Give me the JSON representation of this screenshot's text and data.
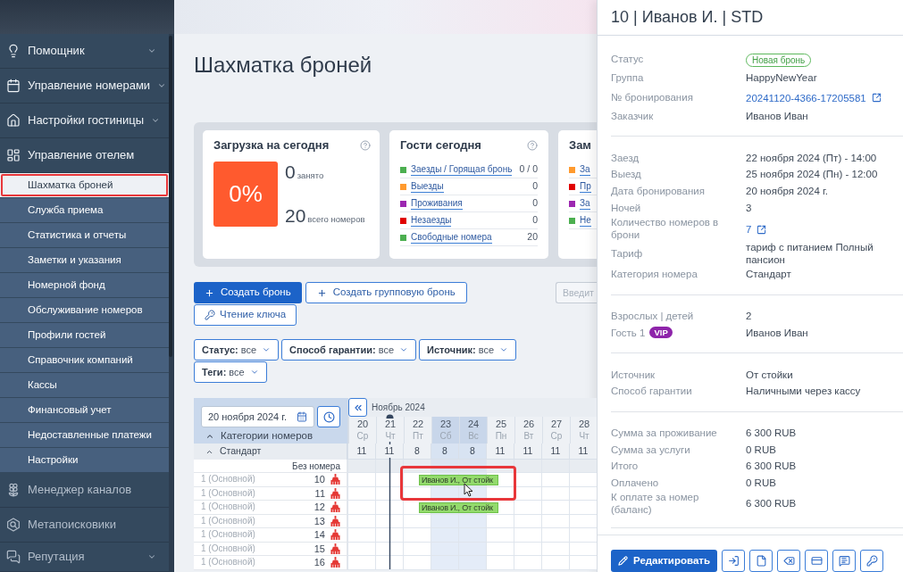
{
  "sidebar": {
    "items": [
      {
        "label": "Помощник",
        "kind": "menu",
        "expanded": false,
        "disabled": false
      },
      {
        "label": "Управление номерами",
        "kind": "menu",
        "expanded": false,
        "disabled": false
      },
      {
        "label": "Настройки гостиницы",
        "kind": "menu",
        "expanded": false,
        "disabled": false
      },
      {
        "label": "Управление отелем",
        "kind": "menu",
        "expanded": true,
        "disabled": false,
        "children": [
          {
            "label": "Шахматка броней",
            "selected": true,
            "highlighted": true
          },
          {
            "label": "Служба приема",
            "selected": false,
            "highlighted": false
          },
          {
            "label": "Статистика и отчеты",
            "selected": false,
            "highlighted": false
          },
          {
            "label": "Заметки и указания",
            "selected": false,
            "highlighted": false
          },
          {
            "label": "Номерной фонд",
            "selected": false,
            "highlighted": false
          },
          {
            "label": "Обслуживание номеров",
            "selected": false,
            "highlighted": false
          },
          {
            "label": "Профили гостей",
            "selected": false,
            "highlighted": false
          },
          {
            "label": "Справочник компаний",
            "selected": false,
            "highlighted": false
          },
          {
            "label": "Кассы",
            "selected": false,
            "highlighted": false
          },
          {
            "label": "Финансовый учет",
            "selected": false,
            "highlighted": false
          },
          {
            "label": "Недоставленные платежи",
            "selected": false,
            "highlighted": false
          },
          {
            "label": "Настройки",
            "selected": false,
            "highlighted": false
          }
        ]
      },
      {
        "label": "Менеджер каналов",
        "kind": "link",
        "disabled": true
      },
      {
        "label": "Метапоисковики",
        "kind": "link",
        "disabled": true
      },
      {
        "label": "Репутация",
        "kind": "menu",
        "expanded": false,
        "disabled": true
      }
    ]
  },
  "page": {
    "title": "Шахматка броней"
  },
  "dashboard": {
    "cards": [
      {
        "kind": "occupancy",
        "title": "Загрузка на сегодня",
        "help": true,
        "percent": "0%",
        "occupied": "0",
        "occupied_label": "занято",
        "total": "20",
        "total_label": "всего номеров"
      },
      {
        "kind": "list",
        "title": "Гости сегодня",
        "help": true,
        "items": [
          {
            "label": "Заезды / Горящая бронь",
            "value": "0 / 0",
            "color": "#4caf50"
          },
          {
            "label": "Выезды",
            "value": "0",
            "color": "#ff9a2e"
          },
          {
            "label": "Проживания",
            "value": "0",
            "color": "#9c27b0"
          },
          {
            "label": "Незаезды",
            "value": "0",
            "color": "#e00000"
          },
          {
            "label": "Свободные номера",
            "value": "20",
            "color": "#4caf50"
          }
        ]
      },
      {
        "kind": "list",
        "title": "Зам",
        "help": false,
        "items": [
          {
            "label": "За",
            "color": "#ff9a2e"
          },
          {
            "label": "Пр",
            "color": "#e00000"
          },
          {
            "label": "За",
            "color": "#9c27b0"
          },
          {
            "label": "Не",
            "color": "#4caf50"
          }
        ]
      }
    ]
  },
  "toolbar": {
    "buttons": [
      {
        "label": "Создать бронь",
        "kind": "primary"
      },
      {
        "label": "Создать групповую бронь",
        "kind": "outline"
      },
      {
        "label": "Чтение ключа",
        "kind": "key"
      }
    ],
    "search": {
      "placeholder": "Введит"
    }
  },
  "filters": [
    {
      "label": "Статус:",
      "value": "все"
    },
    {
      "label": "Способ гарантии:",
      "value": "все"
    },
    {
      "label": "Источник:",
      "value": "все"
    },
    {
      "label": "Теги:",
      "value": "все"
    }
  ],
  "calendar": {
    "date_field": {
      "value": "20 ноября 2024 г."
    },
    "categories_header": {
      "label": "Категории номеров",
      "expanded": true
    },
    "month": "Ноябрь 2024",
    "days": [
      {
        "day": "20",
        "weekday": "Ср",
        "weekend": false
      },
      {
        "day": "21",
        "weekday": "Чт",
        "weekend": false
      },
      {
        "day": "22",
        "weekday": "Пт",
        "weekend": false
      },
      {
        "day": "23",
        "weekday": "Сб",
        "weekend": true
      },
      {
        "day": "24",
        "weekday": "Вс",
        "weekend": true
      },
      {
        "day": "25",
        "weekday": "Пн",
        "weekend": false
      },
      {
        "day": "26",
        "weekday": "Вт",
        "weekend": false
      },
      {
        "day": "27",
        "weekday": "Ср",
        "weekend": false
      },
      {
        "day": "28",
        "weekday": "Чт",
        "weekend": false
      }
    ],
    "category": {
      "name": "Стандарт",
      "expanded": true,
      "availability": [
        "11",
        "11",
        "8",
        "8",
        "8",
        "11",
        "11",
        "11",
        "11"
      ]
    },
    "unassigned": {
      "label": "Без номера"
    },
    "rooms": [
      {
        "type": "1 (Основной)",
        "number": "10",
        "dirty": true,
        "bookings": [
          {
            "label": "Иванов И., От стойк",
            "highlighted": true
          }
        ]
      },
      {
        "type": "1 (Основной)",
        "number": "11",
        "dirty": true
      },
      {
        "type": "1 (Основной)",
        "number": "12",
        "dirty": true,
        "bookings": [
          {
            "label": "Иванов И., От стойк",
            "highlighted": false
          }
        ]
      },
      {
        "type": "1 (Основной)",
        "number": "13",
        "dirty": true
      },
      {
        "type": "1 (Основной)",
        "number": "14",
        "dirty": true
      },
      {
        "type": "1 (Основной)",
        "number": "15",
        "dirty": true
      },
      {
        "type": "1 (Основной)",
        "number": "16",
        "dirty": true
      }
    ]
  },
  "details": {
    "title": "10 | Иванов И. | STD",
    "sections": [
      {
        "rows": [
          {
            "label": "Статус",
            "value": "Новая бронь",
            "kind": "badge"
          },
          {
            "label": "Группа",
            "value": "HappyNewYear",
            "kind": "text"
          },
          {
            "label": "№ бронирования",
            "value": "20241120-4366-17205581",
            "kind": "link"
          },
          {
            "label": "Заказчик",
            "value": "Иванов Иван",
            "kind": "text"
          }
        ]
      },
      {
        "rows": [
          {
            "label": "Заезд",
            "value": "22 ноября 2024 (Пт) - 14:00",
            "kind": "text"
          },
          {
            "label": "Выезд",
            "value": "25 ноября 2024 (Пн) - 12:00",
            "kind": "text"
          },
          {
            "label": "Дата бронирования",
            "value": "20 ноября 2024 г.",
            "kind": "text"
          },
          {
            "label": "Ночей",
            "value": "3",
            "kind": "text"
          },
          {
            "label": "Количество номеров в брони",
            "value": "7",
            "kind": "link"
          },
          {
            "label": "Тариф",
            "value": "тариф с питанием Полный пансион",
            "kind": "text"
          },
          {
            "label": "Категория номера",
            "value": "Стандарт",
            "kind": "text"
          }
        ]
      },
      {
        "rows": [
          {
            "label": "Взрослых | детей",
            "value": "2",
            "kind": "text"
          },
          {
            "label": "Гость 1",
            "label_badge": "VIP",
            "value": "Иванов Иван",
            "kind": "text"
          }
        ]
      },
      {
        "rows": [
          {
            "label": "Источник",
            "value": "От стойки",
            "kind": "text"
          },
          {
            "label": "Способ гарантии",
            "value": "Наличными через кассу",
            "kind": "text"
          }
        ]
      },
      {
        "rows": [
          {
            "label": "Сумма за проживание",
            "value": "6 300 RUB",
            "kind": "text"
          },
          {
            "label": "Сумма за услуги",
            "value": "0 RUB",
            "kind": "text"
          },
          {
            "label": "Итого",
            "value": "6 300 RUB",
            "kind": "text"
          },
          {
            "label": "Оплачено",
            "value": "0 RUB",
            "kind": "text"
          },
          {
            "label": "К оплате за номер (баланс)",
            "value": "6 300 RUB",
            "kind": "text"
          }
        ]
      }
    ],
    "edit_button": "Редактировать"
  }
}
